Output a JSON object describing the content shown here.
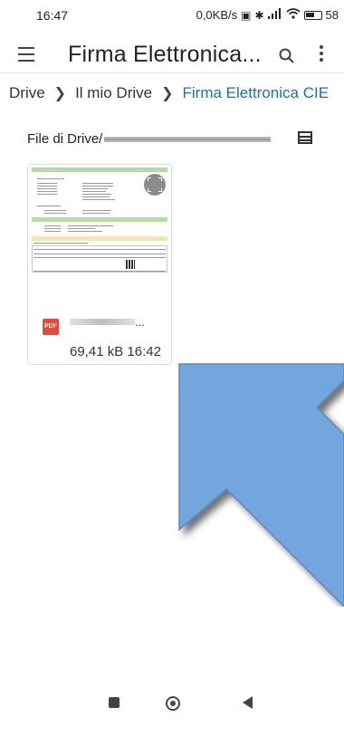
{
  "status_bar": {
    "time": "16:47",
    "network_speed": "0,0KB/s",
    "battery": "58",
    "battery_level": 0.58
  },
  "toolbar": {
    "title": "Firma Elettronica..."
  },
  "breadcrumb": {
    "items": [
      "Drive",
      "Il mio Drive",
      "Firma Elettronica CIE"
    ]
  },
  "section": {
    "label": "File di Drive/"
  },
  "file": {
    "type_badge": "PDF",
    "name_suffix": "...",
    "size": "69,41 kB",
    "time": "16:42"
  },
  "colors": {
    "accent": "#1a73a0",
    "pdf_red": "#e04a3f",
    "arrow_blue": "#6fa3d9"
  }
}
